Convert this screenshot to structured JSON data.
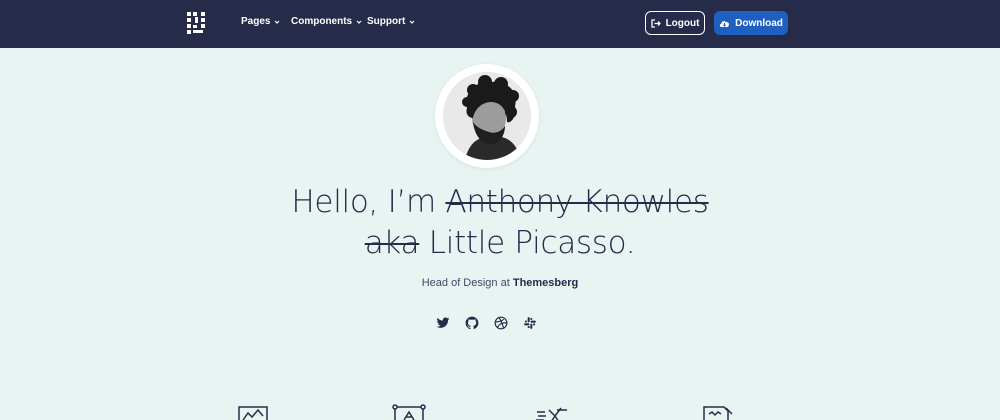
{
  "navbar": {
    "logo_icon": "brand-logo-icon",
    "links": [
      {
        "label": "Pages"
      },
      {
        "label": "Components"
      },
      {
        "label": "Support"
      }
    ],
    "logout_label": "Logout",
    "download_label": "Download",
    "colors": {
      "background": "#262b4a",
      "download_button": "#1f5fbf"
    }
  },
  "hero": {
    "greeting": "Hello, I’m",
    "name": "Anthony Knowles",
    "aka": "aka",
    "alias": "Little Picasso.",
    "subtitle_prefix": "Head of Design at",
    "company": "Themesberg",
    "background": "#e8f4f2"
  },
  "socials": [
    "twitter-icon",
    "github-icon",
    "dribbble-icon",
    "slack-icon"
  ],
  "features": [
    "presentation-icon",
    "design-board-icon",
    "drone-icon",
    "document-icon"
  ]
}
